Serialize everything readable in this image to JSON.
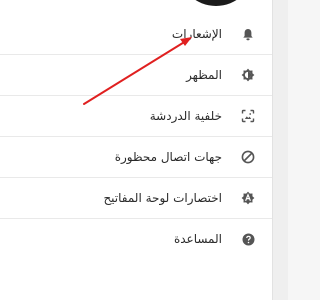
{
  "menu": {
    "items": [
      {
        "label": "الإشعارات",
        "icon": "bell-icon"
      },
      {
        "label": "المظهر",
        "icon": "brightness-icon"
      },
      {
        "label": "خلفية الدردشة",
        "icon": "wallpaper-icon"
      },
      {
        "label": "جهات اتصال محظورة",
        "icon": "block-icon"
      },
      {
        "label": "اختصارات لوحة المفاتيح",
        "icon": "keyboard-shortcut-icon"
      },
      {
        "label": "المساعدة",
        "icon": "help-icon"
      }
    ]
  },
  "colors": {
    "icon": "#555555",
    "text": "#2a2a2a",
    "divider": "#e9e9e9",
    "arrow": "#e02020"
  }
}
